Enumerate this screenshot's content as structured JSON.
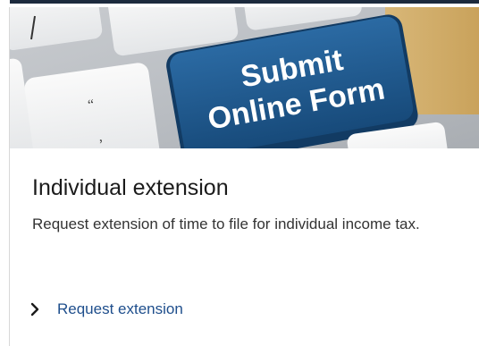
{
  "hero": {
    "key_line1": "Submit",
    "key_line2": "Online Form",
    "key_glyph_quote": "“",
    "key_glyph_comma": ",",
    "image_icon": "keyboard-submit-key-image"
  },
  "card": {
    "title": "Individual extension",
    "description": "Request extension of time to file for individual income tax.",
    "link_label": "Request extension",
    "link_icon": "chevron-right-icon"
  },
  "colors": {
    "title": "#1b1b1b",
    "description": "#333333",
    "link": "#1e4e8c",
    "key_blue": "#1f5b8f",
    "top_bar": "#1c2a3d"
  }
}
